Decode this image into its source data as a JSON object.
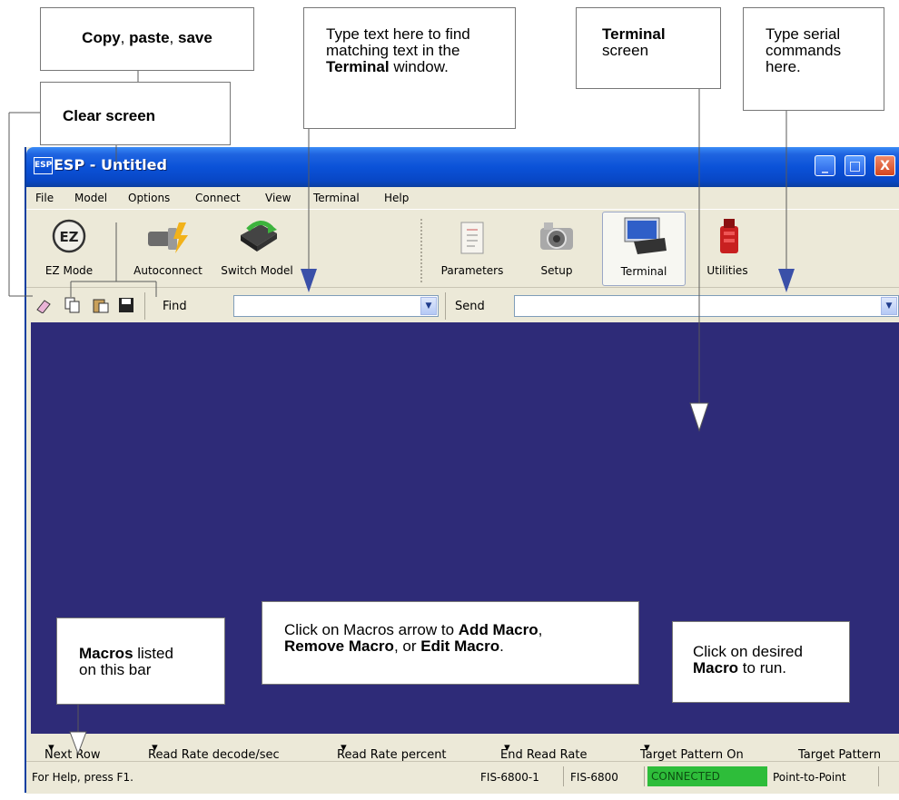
{
  "callouts": {
    "copy_paste_save": {
      "b1": "Copy",
      "t1": ", ",
      "b2": "paste",
      "t2": ", ",
      "b3": "save"
    },
    "clear_screen": "Clear screen",
    "find_hint": {
      "pre": "Type text here to find matching text in the ",
      "bold": "Terminal",
      "post": " window."
    },
    "terminal_screen": {
      "bold": "Terminal",
      "post": "screen"
    },
    "serial_hint": "Type serial commands here.",
    "macros_menu_hint": {
      "p1": "Click on Macros arrow to ",
      "b1": "Add Macro",
      "p2": ",",
      "b2": "Remove Macro",
      "p3": ", or ",
      "b3": "Edit Macro",
      "p4": "."
    },
    "macros_bar": {
      "bold": "Macros",
      "post1": " listed",
      "post2": "on this bar"
    },
    "run_macro": {
      "pre": "Click on desired",
      "bold": "Macro",
      "post": " to run."
    }
  },
  "window": {
    "title": "ESP - Untitled",
    "app_icon": "ESP",
    "buttons": {
      "minimize": "_",
      "maximize": "□",
      "close": "X"
    }
  },
  "menu": [
    "File",
    "Model",
    "Options",
    "Connect",
    "View",
    "Terminal",
    "Help"
  ],
  "toolbar": {
    "ez_mode": "EZ Mode",
    "autoconnect": "Autoconnect",
    "switch_model": "Switch Model",
    "parameters": "Parameters",
    "setup": "Setup",
    "terminal": "Terminal",
    "utilities": "Utilities",
    "ez_glyph": "EZ"
  },
  "findbar": {
    "find_label": "Find",
    "find_value": "",
    "send_label": "Send",
    "send_value": "",
    "icons": [
      "eraser-icon",
      "copy-icon",
      "paste-icon",
      "save-icon"
    ]
  },
  "macros": [
    "Next Row",
    "Read Rate decode/sec",
    "Read Rate percent",
    "End Read Rate",
    "Target Pattern On",
    "Target Pattern"
  ],
  "status": {
    "help": "For Help, press F1.",
    "device": "FIS-6800-1",
    "model": "FIS-6800",
    "connection": "CONNECTED",
    "mode": "Point-to-Point"
  },
  "colors": {
    "terminal_bg": "#2e2b78",
    "connected": "#2ebd3a",
    "arrow": "#3a50a8"
  }
}
